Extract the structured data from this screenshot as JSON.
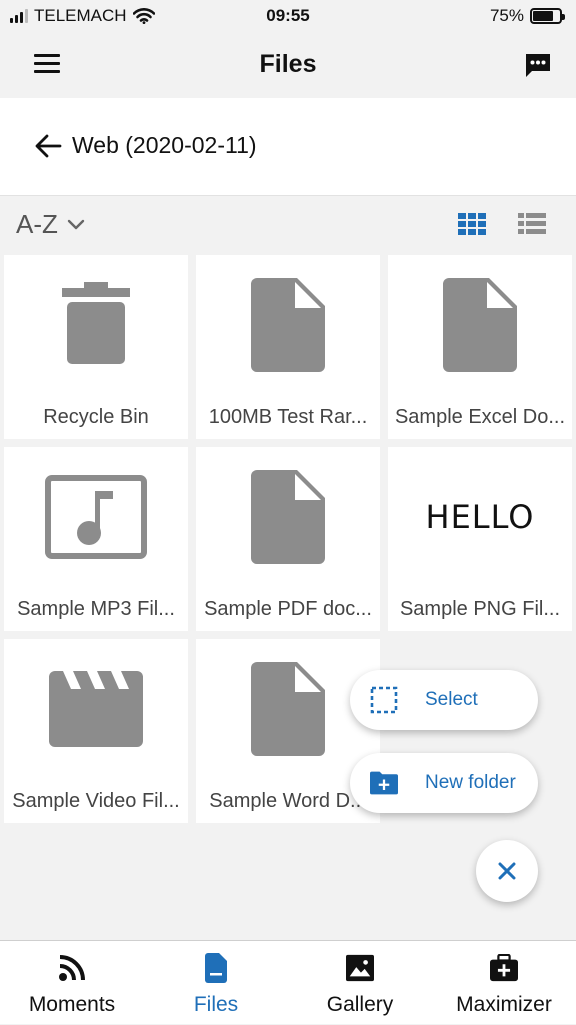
{
  "status_bar": {
    "carrier": "TELEMACH",
    "time": "09:55",
    "battery": "75%",
    "battery_level": 0.75
  },
  "header": {
    "title": "Files",
    "menu_icon": "hamburger-icon",
    "chat_icon": "chat-icon"
  },
  "breadcrumb": {
    "back_icon": "arrow-left-icon",
    "folder_name": "Web (2020-02-11)"
  },
  "toolbar": {
    "sort_label": "A-Z",
    "grid_view_icon": "grid-view-icon",
    "list_view_icon": "list-view-icon"
  },
  "files": [
    {
      "name": "Recycle Bin",
      "icon": "trash-icon"
    },
    {
      "name": "100MB Test Rar...",
      "icon": "file-icon"
    },
    {
      "name": "Sample Excel Do...",
      "icon": "file-icon"
    },
    {
      "name": "Sample MP3 Fil...",
      "icon": "music-icon"
    },
    {
      "name": "Sample PDF doc...",
      "icon": "file-icon"
    },
    {
      "name": "Sample PNG Fil...",
      "icon": "image-thumbnail",
      "thumbnail_text": "HELLO"
    },
    {
      "name": "Sample Video Fil...",
      "icon": "video-icon"
    },
    {
      "name": "Sample Word D...",
      "icon": "file-icon"
    }
  ],
  "fab_menu": {
    "select_label": "Select",
    "new_folder_label": "New folder",
    "close_icon": "close-icon"
  },
  "tabs": [
    {
      "label": "Moments",
      "icon": "rss-icon"
    },
    {
      "label": "Files",
      "icon": "file-tab-icon",
      "active": true
    },
    {
      "label": "Gallery",
      "icon": "gallery-icon"
    },
    {
      "label": "Maximizer",
      "icon": "maximizer-icon"
    }
  ],
  "colors": {
    "accent": "#1f6fb8",
    "icon_gray": "#8c8c8c",
    "background": "#f2f2f2"
  }
}
